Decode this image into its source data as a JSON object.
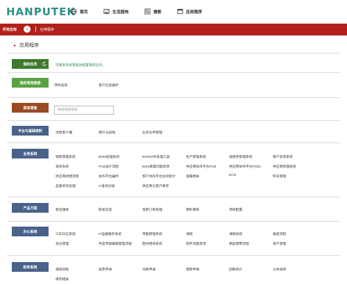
{
  "header": {
    "logo": "HANPUTEK",
    "nav": [
      {
        "label": "首页",
        "icon": "globe-icon"
      },
      {
        "label": "生活园地",
        "icon": "image-icon"
      },
      {
        "label": "搜索",
        "icon": "search-icon"
      },
      {
        "label": "应用程序",
        "icon": "apps-icon"
      }
    ]
  },
  "breadcrumb_bar": {
    "all_apps": "所有应用",
    "crumb": "应用程序"
  },
  "page_title": "应用程序",
  "my_tasks": {
    "label": "我的任务",
    "message": "可联系系统管理员配置我的任务。"
  },
  "my_apps": {
    "label": "我的常用链接",
    "items": [
      "项目查询",
      "客户信息维护"
    ]
  },
  "menu_search": {
    "label": "菜单搜索",
    "placeholder": "快速搜索菜单"
  },
  "groups": [
    {
      "label": "平台与基础资料",
      "items": [
        [
          "流程客户端",
          "用户与权限",
          "业务伙伴管理"
        ]
      ]
    },
    {
      "label": "业务系统",
      "items": [
        [
          "销售管理系统",
          "BOM处理系统",
          "BOM分析处理工具",
          "生产管理系统",
          "进销存管理系统",
          "客户反馈系统"
        ],
        [
          "发货系统",
          "PCB设计流程",
          "EMS质量问题反馈",
          "供应商协作平台PCB",
          "供应商协作平台PCBA",
          "供应商管理系统"
        ],
        [
          "供应商新建流程",
          "协作平台器件",
          "客户协作平台访问统计",
          "金蝶相关",
          "ECN",
          "料号管理"
        ],
        [
          "品质异常处理",
          "IT查询对接",
          "供应商与客户库存"
        ]
      ]
    },
    {
      "label": "产品方案",
      "items": [
        [
          "售后维修",
          "研发实验",
          "电商订单处理",
          "物料审核",
          "项目配置"
        ]
      ]
    },
    {
      "label": "办公系统",
      "items": [
        [
          "工作日志系统",
          "IT运维服务系统",
          "考勤管理系统",
          "请假",
          "请假加班",
          "报道流程"
        ],
        [
          "会议管理",
          "月度考核跟踪管理流程",
          "图书借阅系统",
          "软件问题反馈",
          "物品借用流程",
          "资产管理"
        ]
      ]
    },
    {
      "label": "财务系统",
      "items": [
        [
          "报销流程",
          "发票申请",
          "付款申请",
          "借款申请",
          "回款统计",
          "公共采购"
        ],
        [
          "库存相关"
        ]
      ]
    }
  ],
  "colors": {
    "brand": "#2f8f86",
    "red_bar": "#b2201c",
    "tag_dark_green": "#3f7a2d",
    "tag_green": "#5aa240",
    "tag_brown": "#9a4a23",
    "tag_blue": "#49628a"
  }
}
